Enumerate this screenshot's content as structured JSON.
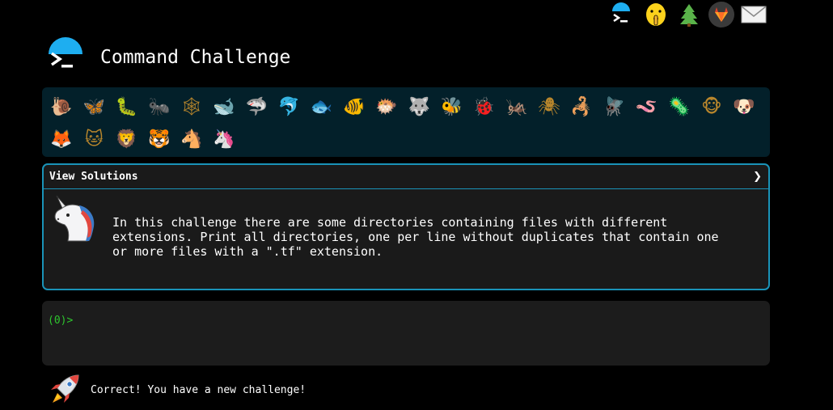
{
  "app": {
    "title": "Command Challenge"
  },
  "topbar": {
    "icons": [
      {
        "name": "terminal-icon",
        "glyph": "⌨"
      },
      {
        "name": "shushing-face-icon",
        "glyph": "🤫"
      },
      {
        "name": "tree-icon",
        "glyph": "🌲"
      },
      {
        "name": "gitlab-icon",
        "glyph": "🦊"
      },
      {
        "name": "mail-icon",
        "glyph": "✉"
      }
    ]
  },
  "emoji_bar": {
    "rows": [
      [
        {
          "name": "snail-icon",
          "glyph": "🐌"
        },
        {
          "name": "butterfly-icon",
          "glyph": "🦋"
        },
        {
          "name": "caterpillar-icon",
          "glyph": "🐛"
        },
        {
          "name": "ant-icon",
          "glyph": "🐜"
        },
        {
          "name": "spiderweb-icon",
          "glyph": "🕸"
        },
        {
          "name": "whale-icon",
          "glyph": "🐋"
        },
        {
          "name": "shark-icon",
          "glyph": "🦈"
        },
        {
          "name": "dolphin-icon",
          "glyph": "🐬"
        },
        {
          "name": "fish-icon",
          "glyph": "🐟"
        },
        {
          "name": "tropical-fish-icon",
          "glyph": "🐠"
        },
        {
          "name": "blowfish-icon",
          "glyph": "🐡"
        },
        {
          "name": "wolf-icon",
          "glyph": "🐺"
        },
        {
          "name": "bee-icon",
          "glyph": "🐝"
        },
        {
          "name": "ladybug-icon",
          "glyph": "🐞"
        },
        {
          "name": "cricket-icon",
          "glyph": "🦗"
        },
        {
          "name": "spider-icon",
          "glyph": "🕷"
        },
        {
          "name": "scorpion-icon",
          "glyph": "🦂"
        },
        {
          "name": "fly-icon",
          "glyph": "🪰"
        },
        {
          "name": "worm-icon",
          "glyph": "🪱"
        },
        {
          "name": "microbe-icon",
          "glyph": "🦠"
        },
        {
          "name": "monkey-icon",
          "glyph": "🐵"
        },
        {
          "name": "dog-icon",
          "glyph": "🐶"
        }
      ],
      [
        {
          "name": "fox-icon",
          "glyph": "🦊"
        },
        {
          "name": "cat-icon",
          "glyph": "🐱"
        },
        {
          "name": "lion-icon",
          "glyph": "🦁"
        },
        {
          "name": "tiger-icon",
          "glyph": "🐯"
        },
        {
          "name": "horse-icon",
          "glyph": "🐴"
        },
        {
          "name": "unicorn-icon",
          "glyph": "🦄"
        }
      ]
    ]
  },
  "solutions": {
    "header_label": "View Solutions",
    "chevron": "❯",
    "challenge_text": "In this challenge there are some directories containing files with different\nextensions. Print all directories, one per line without duplicates that contain one\nor more files with a \".tf\" extension."
  },
  "terminal": {
    "prompt": "(0)>"
  },
  "status": {
    "rocket_glyph": "🚀",
    "message": "Correct! You have a new challenge!"
  },
  "colors": {
    "background": "#000000",
    "accent": "#1a93b8",
    "emoji_bar_bg": "#03202a",
    "panel_bg": "#1a1a1a",
    "prompt_green": "#2ec52e",
    "logo_blue": "#1eaef0"
  }
}
